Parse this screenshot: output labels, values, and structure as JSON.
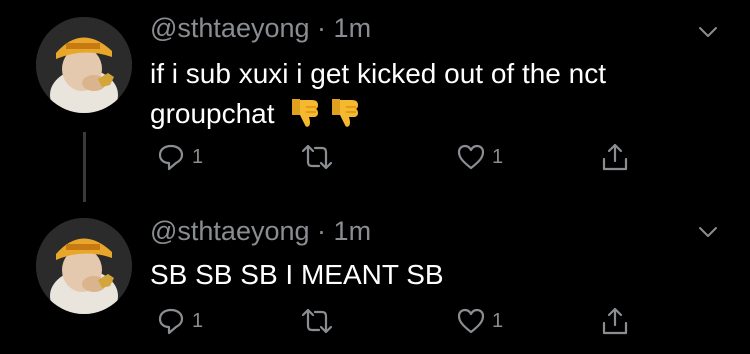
{
  "tweets": [
    {
      "handle": "@sthtaeyong",
      "separator": "·",
      "time": "1m",
      "text": "if i sub xuxi  i get kicked out of the nct groupchat",
      "emoji": [
        "thumbs-down-icon",
        "thumbs-down-icon"
      ],
      "reply_count": "1",
      "retweet_count": "",
      "like_count": "1"
    },
    {
      "handle": "@sthtaeyong",
      "separator": "·",
      "time": "1m",
      "text": "SB SB SB I MEANT SB",
      "emoji": [],
      "reply_count": "1",
      "retweet_count": "",
      "like_count": "1"
    }
  ],
  "colors": {
    "background": "#000000",
    "meta": "#8a8d91",
    "text": "#ffffff",
    "thread_line": "#3a3a3a",
    "emoji": "#f5b82e"
  }
}
